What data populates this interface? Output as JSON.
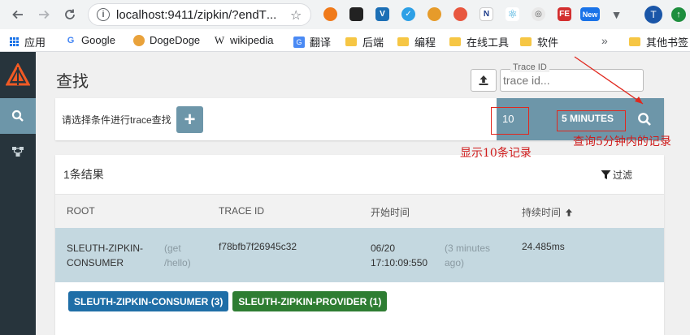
{
  "browser": {
    "url": "localhost:9411/zipkin/?endT",
    "ellipsis": "...",
    "profile_initial": "T",
    "ext_new_label": "New",
    "ext_fe_label": "FE",
    "ext_n_label": "N"
  },
  "bookmarks": {
    "items": [
      "应用",
      "Google",
      "DogeDoge",
      "wikipedia",
      "翻译",
      "后端",
      "编程",
      "在线工具",
      "软件"
    ],
    "overflow": "»",
    "other": "其他书签"
  },
  "page": {
    "title": "查找",
    "trace_id_label": "Trace ID",
    "trace_id_placeholder": "trace id..."
  },
  "search": {
    "prompt": "请选择条件进行trace查找",
    "add_label": "+",
    "limit": "10",
    "lookback": "5 MINUTES"
  },
  "results": {
    "count_label": "1条结果",
    "filter_label": "过滤",
    "columns": [
      "ROOT",
      "TRACE ID",
      "开始时间",
      "持续时间"
    ],
    "row": {
      "root_service": "SLEUTH-ZIPKIN-CONSUMER",
      "root_span": "(get /hello)",
      "trace_id": "f78bfb7f26945c32",
      "start_time": "06/20 17:10:09:550",
      "start_relative": "(3 minutes ago)",
      "duration": "24.485ms"
    },
    "tags": [
      {
        "label": "SLEUTH-ZIPKIN-CONSUMER (3)",
        "color": "#1f6ea7"
      },
      {
        "label": "SLEUTH-ZIPKIN-PROVIDER (1)",
        "color": "#2e7d32"
      }
    ]
  },
  "annotations": {
    "limit_note": "显示10条记录",
    "lookback_note": "查询5分钟内的记录"
  },
  "colors": {
    "accent": "#6d96a9",
    "sidebar": "#27343c",
    "annotation": "#e0281e"
  }
}
